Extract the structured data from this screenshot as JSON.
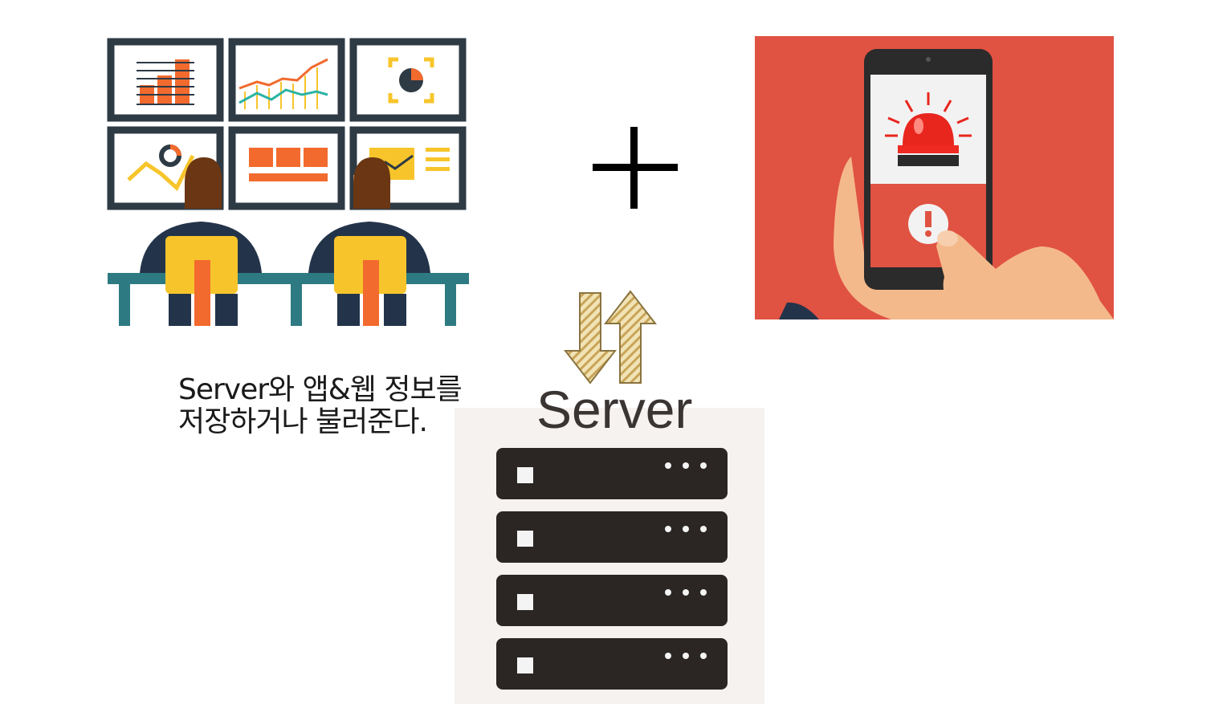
{
  "caption": {
    "line1": "Server와 앱&웹 정보를",
    "line2": "저장하거나 불러준다."
  },
  "server": {
    "label": "Server"
  },
  "colors": {
    "alert_background": "#e05242",
    "panel_frame": "#2e3a44",
    "chart_orange": "#f26a2e",
    "chair_yellow": "#f7c52b",
    "rack_dark": "#2b2624",
    "arrow_gold": "#e2c07a"
  },
  "icons": {
    "monitoring": "monitoring-team-icon",
    "plus": "plus-icon",
    "alert": "mobile-alert-icon",
    "transfer": "transfer-arrows-icon",
    "server": "server-rack-icon"
  }
}
